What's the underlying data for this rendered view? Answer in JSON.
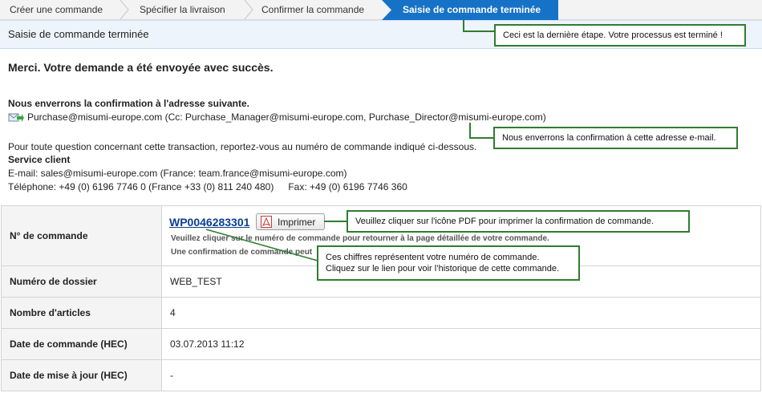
{
  "steps": [
    {
      "label": "Créer une commande"
    },
    {
      "label": "Spécifier la livraison"
    },
    {
      "label": "Confirmer la commande"
    },
    {
      "label": "Saisie de commande terminée"
    }
  ],
  "header": {
    "title": "Saisie de commande terminée"
  },
  "callouts": {
    "last_step": "Ceci est la dernière étape. Votre processus est terminé !",
    "email": "Nous enverrons la confirmation à cette adresse e-mail.",
    "pdf": "Veuillez cliquer sur l'icône PDF pour imprimer la confirmation de commande.",
    "number_line1": "Ces chiffres représentent votre numéro de commande.",
    "number_line2": "Cliquez sur le lien pour voir l’historique de cette commande."
  },
  "message": {
    "thanks": "Merci. Votre demande a été envoyée avec succès.",
    "confirmation_title": "Nous enverrons la confirmation à l'adresse suivante.",
    "email": "Purchase@misumi-europe.com (Cc: Purchase_Manager@misumi-europe.com, Purchase_Director@misumi-europe.com)",
    "question": "Pour toute question concernant cette transaction, reportez-vous au numéro de commande indiqué ci-dessous.",
    "service_title": "Service client",
    "service_email": "E-mail: sales@misumi-europe.com (France: team.france@misumi-europe.com)",
    "phone": "Téléphone: +49 (0) 6196 7746 0 (France +33 (0) 811 240 480)",
    "fax": "Fax: +49 (0) 6196 7746 360"
  },
  "order": {
    "label": "N° de commande",
    "number": "WP0046283301",
    "print_label": "Imprimer",
    "hint1": "Veuillez cliquer sur le numéro de commande pour retourner à la page détaillée de votre commande.",
    "hint2": "Une confirmation de commande peut"
  },
  "rows": [
    {
      "label": "Numéro de dossier",
      "value": "WEB_TEST"
    },
    {
      "label": "Nombre d'articles",
      "value": "4"
    },
    {
      "label": "Date de commande (HEC)",
      "value": "03.07.2013 11:12"
    },
    {
      "label": "Date de mise à jour (HEC)",
      "value": "-"
    }
  ],
  "colors": {
    "accent": "#1672c6",
    "callout_border": "#2f7d2f",
    "link": "#0b3d91"
  },
  "icons": [
    "mail-forward-icon",
    "pdf-icon"
  ]
}
